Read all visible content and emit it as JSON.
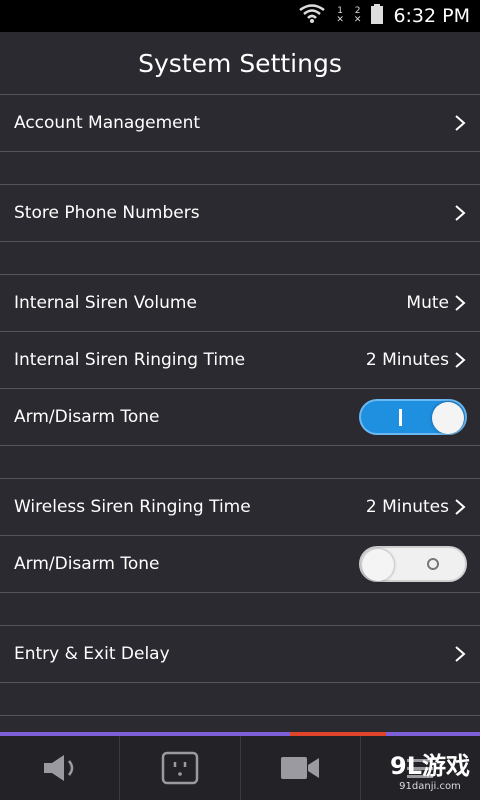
{
  "status_bar": {
    "time": "6:32 PM",
    "sim1": "1",
    "sim2": "2"
  },
  "header": {
    "title": "System Settings"
  },
  "rows": {
    "account": {
      "label": "Account Management"
    },
    "phones": {
      "label": "Store Phone Numbers"
    },
    "internal_volume": {
      "label": "Internal Siren Volume",
      "value": "Mute"
    },
    "internal_ringing": {
      "label": "Internal Siren Ringing Time",
      "value": "2 Minutes"
    },
    "internal_tone": {
      "label": "Arm/Disarm Tone",
      "state": "on"
    },
    "wireless_ringing": {
      "label": "Wireless Siren Ringing Time",
      "value": "2 Minutes"
    },
    "wireless_tone": {
      "label": "Arm/Disarm Tone",
      "state": "off"
    },
    "entry_exit": {
      "label": "Entry & Exit Delay"
    }
  },
  "tabbar": {
    "tabs": [
      {
        "icon": "speaker-icon"
      },
      {
        "icon": "outlet-icon"
      },
      {
        "icon": "video-camera-icon"
      },
      {
        "icon": "menu-icon"
      }
    ]
  },
  "watermark": {
    "main": "9L游戏",
    "sub": "91danji.com"
  },
  "colors": {
    "toggle_on": "#1f8fe0",
    "tab_accent": "#e0452c",
    "tab_border": "#7d5fd8"
  }
}
